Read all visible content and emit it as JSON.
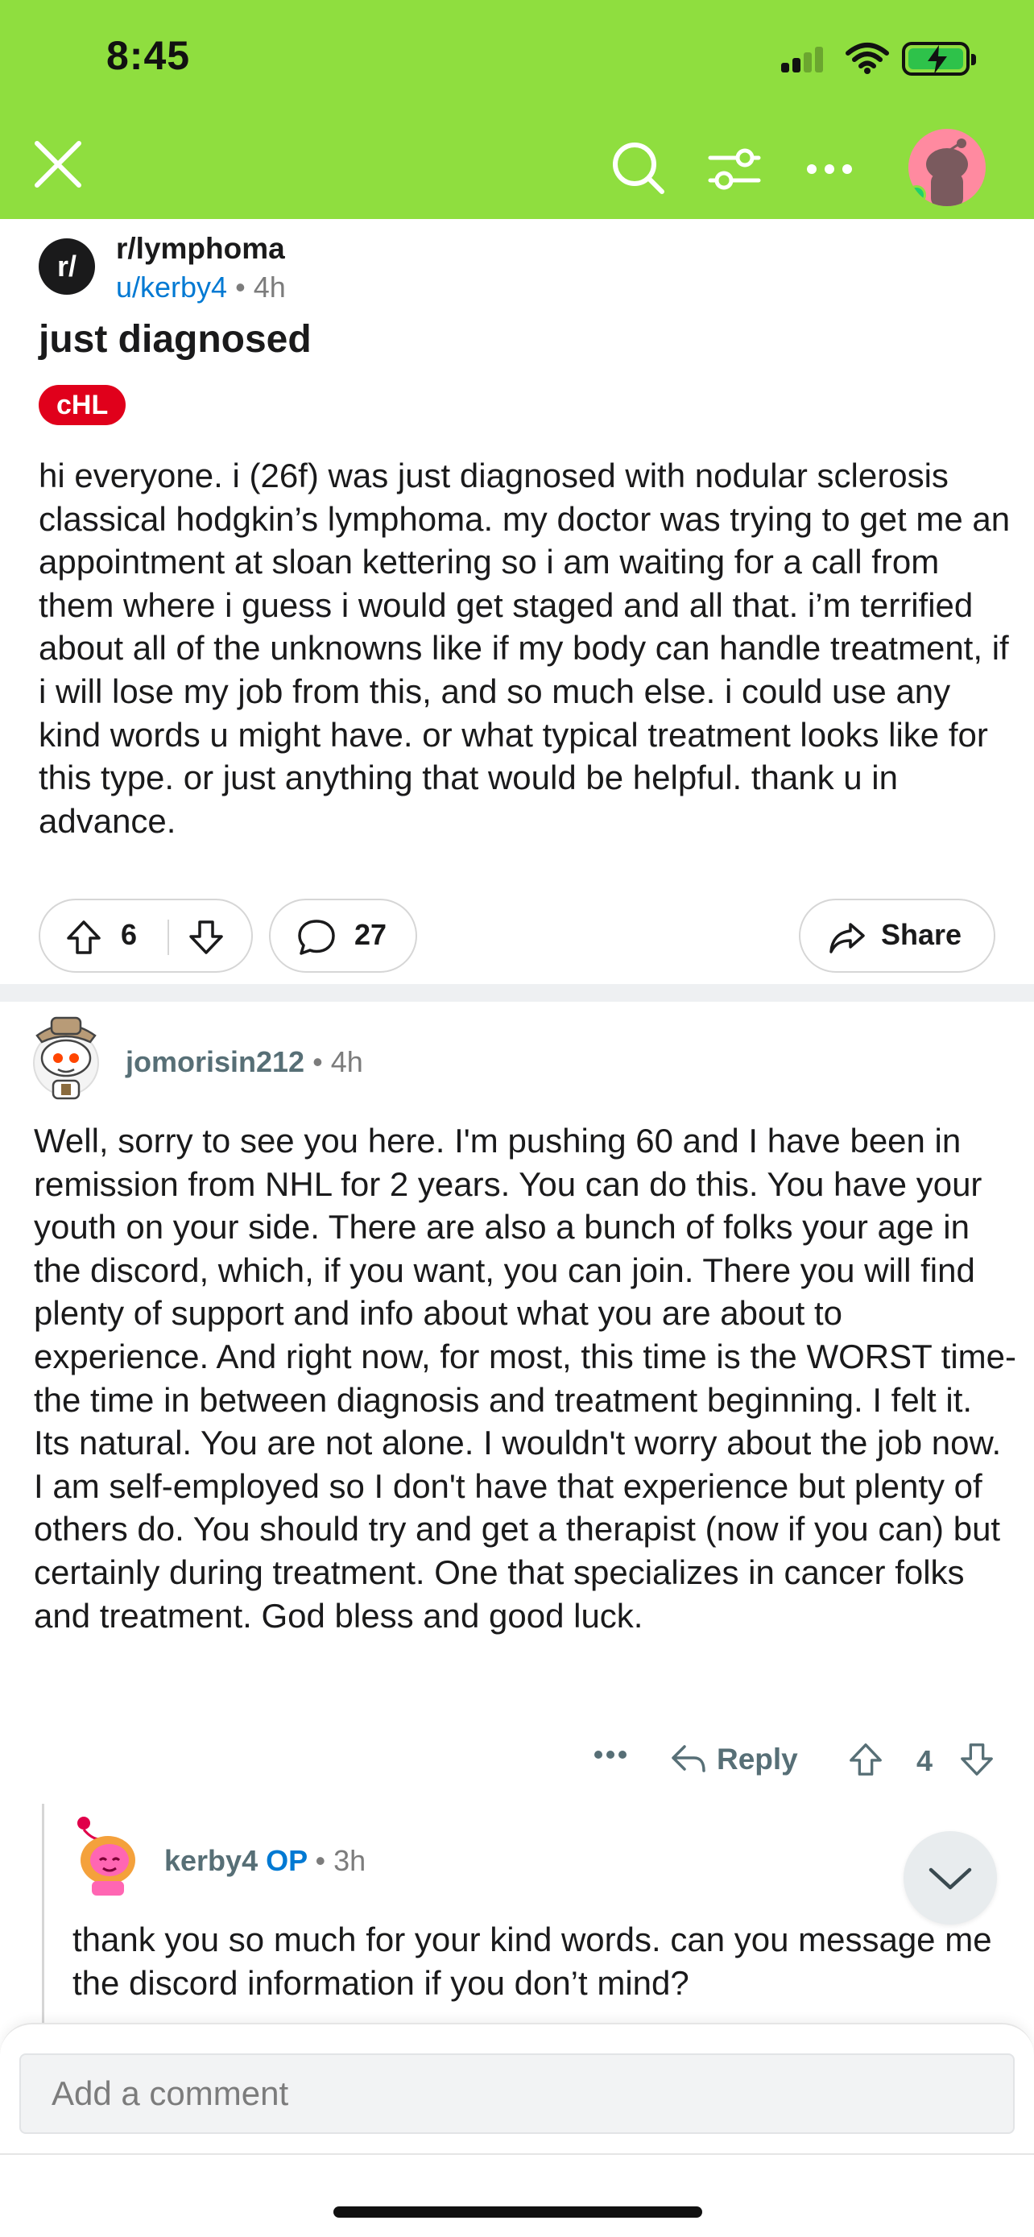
{
  "status_bar": {
    "time": "8:45"
  },
  "post": {
    "subreddit": "r/lymphoma",
    "subreddit_icon_text": "r/",
    "author": "u/kerby4",
    "separator": "•",
    "age": "4h",
    "title": "just diagnosed",
    "flair": "cHL",
    "body": "hi everyone. i (26f) was just diagnosed with nodular sclerosis classical hodgkin’s lymphoma. my doctor was trying to get me an appointment at sloan kettering so i am waiting for a call from them where i guess i would get staged and all that. i’m terrified about all of the unknowns like if my body can handle treatment, if i will lose my job from this, and so much else. i could use any kind words u might have. or what typical treatment looks like for this type. or just anything that would be helpful. thank u in advance.",
    "score": "6",
    "comment_count": "27",
    "share_label": "Share"
  },
  "comments": [
    {
      "author": "jomorisin212",
      "separator": "•",
      "age": "4h",
      "body": "Well, sorry to see you here. I'm pushing 60 and I have been in remission from NHL for 2 years. You can do this. You have your youth on your side. There are also a bunch of folks your age in the discord, which, if you want, you can join. There you will find plenty of support and info about what you are about to experience. And right now, for most, this time is the WORST time-the time in between diagnosis and treatment beginning. I felt it. Its natural. You are not alone. I wouldn't worry about the job now. I am self-employed so I don't have that experience but plenty of others do. You should try and get a therapist (now if you can) but certainly during treatment. One that specializes in cancer folks and treatment. God bless and good luck.",
      "reply_label": "Reply",
      "score": "4"
    },
    {
      "author": "kerby4",
      "op_badge": "OP",
      "separator": "•",
      "age": "3h",
      "body": "thank you so much for your kind words. can you message me the discord information if you don’t mind?"
    }
  ],
  "comment_bar": {
    "placeholder": "Add a comment"
  },
  "icons": [
    "close-icon",
    "search-icon",
    "filter-icon",
    "more-icon",
    "upvote-icon",
    "downvote-icon",
    "comment-icon",
    "share-icon",
    "reply-icon",
    "chevron-down-icon"
  ],
  "colors": {
    "header_bg": "#8fde3f",
    "flair_bg": "#e0001b",
    "link_blue": "#0079d3",
    "online_dot": "#1fd16a"
  }
}
